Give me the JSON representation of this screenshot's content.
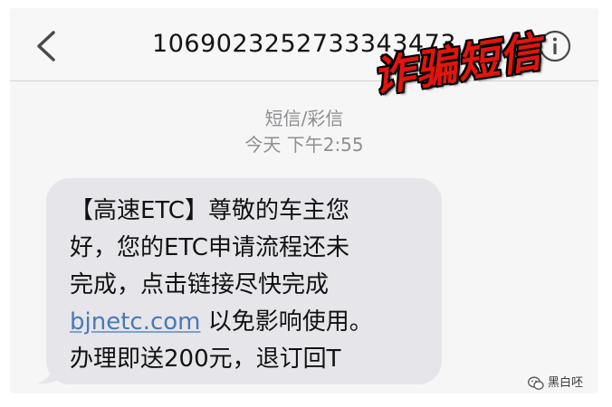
{
  "header": {
    "sender_number": "1069023252733343473",
    "back_icon": "chevron-left-icon",
    "info_icon": "info-icon"
  },
  "stamp": {
    "label": "诈骗短信",
    "color": "#e0150e"
  },
  "thread": {
    "message_type": "短信/彩信",
    "timestamp": "今天 下午2:55"
  },
  "message": {
    "line1": "【高速ETC】尊敬的车主您",
    "line2": "好，您的ETC申请流程还未",
    "line3": "完成，点击链接尽快完成",
    "link_text": "bjnetc.com",
    "line4_rest": " 以免影响使用。",
    "line5": "办理即送200元，退订回T",
    "bubble_color": "#e5e5ea",
    "link_color": "#4a78b8"
  },
  "watermark": {
    "icon": "wechat-icon",
    "label": "黑白呸"
  }
}
